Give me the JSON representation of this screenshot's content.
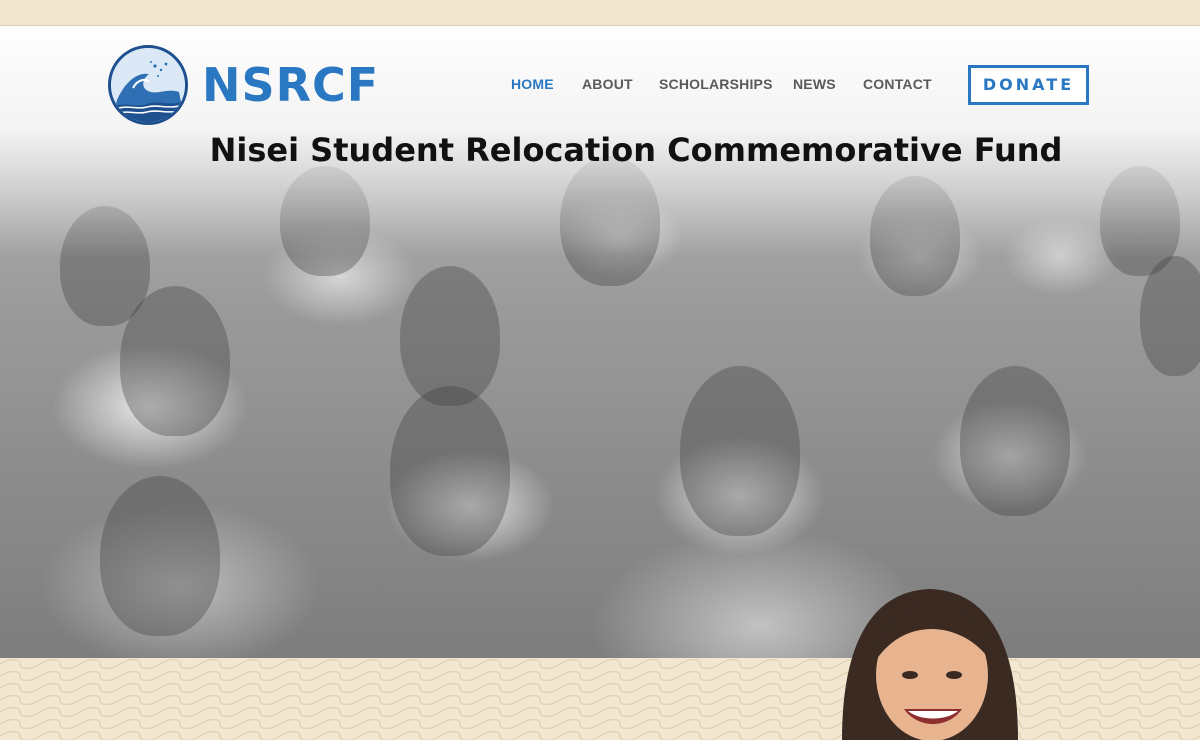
{
  "site": {
    "brand": "NSRCF",
    "headline": "Nisei Student Relocation Commemorative Fund"
  },
  "nav": {
    "items": [
      {
        "label": "HOME",
        "active": true
      },
      {
        "label": "ABOUT",
        "active": false
      },
      {
        "label": "SCHOLARSHIPS",
        "active": false
      },
      {
        "label": "NEWS",
        "active": false
      },
      {
        "label": "CONTACT",
        "active": false
      }
    ],
    "donate_label": "DONATE"
  },
  "colors": {
    "brand_blue": "#2a78c2",
    "logo_ring": "#1e4f8f",
    "beige_band": "#f1e6cf",
    "nav_text": "#5a5a5a"
  },
  "icons": {
    "logo": "wave-logo-icon"
  }
}
